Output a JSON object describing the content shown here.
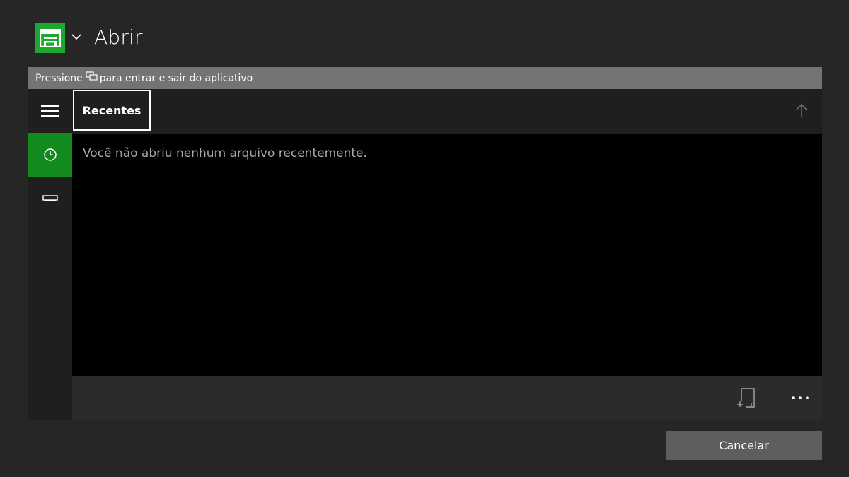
{
  "header": {
    "title": "Abrir",
    "app_icon": "file-explorer-icon",
    "accent": "#1fa82f"
  },
  "hint": {
    "before": "Pressione",
    "icon": "view-button-icon",
    "after": "para entrar e sair do aplicativo"
  },
  "sidebar": {
    "items": [
      {
        "name": "menu",
        "icon": "hamburger-menu-icon",
        "selected": false
      },
      {
        "name": "recent",
        "icon": "clock-icon",
        "selected": true
      },
      {
        "name": "drive",
        "icon": "drive-icon",
        "selected": false
      }
    ],
    "selected_color": "#138a1d"
  },
  "toolbar": {
    "tab_label": "Recentes",
    "up_icon": "arrow-up-icon"
  },
  "content": {
    "empty_message": "Você não abriu nenhum arquivo recentemente."
  },
  "bottombar": {
    "new_folder_icon": "new-folder-icon",
    "more_icon": "more-options-icon"
  },
  "actions": {
    "cancel_label": "Cancelar"
  }
}
